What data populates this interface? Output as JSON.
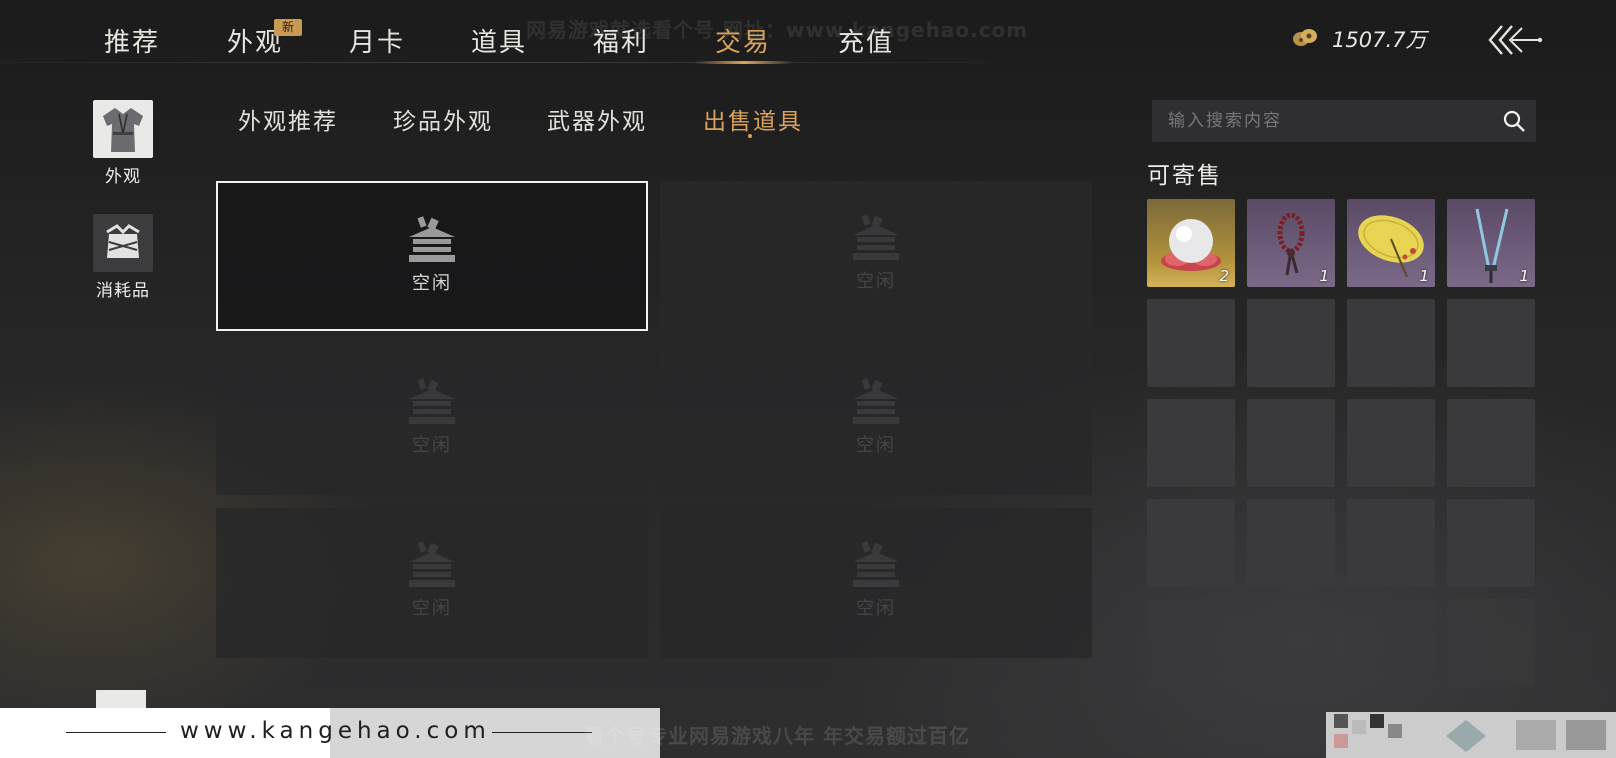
{
  "watermark_top": "网易游戏就选看个号 网址：www.kangehao.com",
  "nav": {
    "tabs": [
      {
        "label": "推荐"
      },
      {
        "label": "外观"
      },
      {
        "label": "月卡"
      },
      {
        "label": "道具"
      },
      {
        "label": "福利"
      },
      {
        "label": "交易"
      },
      {
        "label": "充值"
      }
    ],
    "active_index": 5,
    "new_badge": "新",
    "currency": "1507.7万"
  },
  "categories": [
    {
      "label": "外观",
      "icon": "clothes-icon"
    },
    {
      "label": "消耗品",
      "icon": "bundle-icon"
    }
  ],
  "sub_tabs": [
    {
      "label": "外观推荐"
    },
    {
      "label": "珍品外观"
    },
    {
      "label": "武器外观"
    },
    {
      "label": "出售道具"
    }
  ],
  "sub_active_index": 3,
  "slots": [
    {
      "label": "空闲"
    },
    {
      "label": "空闲"
    },
    {
      "label": "空闲"
    },
    {
      "label": "空闲"
    },
    {
      "label": "空闲"
    },
    {
      "label": "空闲"
    }
  ],
  "selected_slot": 0,
  "search": {
    "placeholder": "输入搜索内容"
  },
  "sellable_title": "可寄售",
  "inventory": [
    {
      "item": "pearl",
      "qty": "2"
    },
    {
      "item": "prayer-beads",
      "qty": "1"
    },
    {
      "item": "yellow-umbrella",
      "qty": "1"
    },
    {
      "item": "twin-blades",
      "qty": "1"
    }
  ],
  "bottom": {
    "url": "www.kangehao.com",
    "slogan": "看个号专业网易游戏八年  年交易额过百亿"
  },
  "colors": {
    "accent": "#d9a25c",
    "badge": "#c99a52",
    "selected_border": "#f2f2f2"
  }
}
